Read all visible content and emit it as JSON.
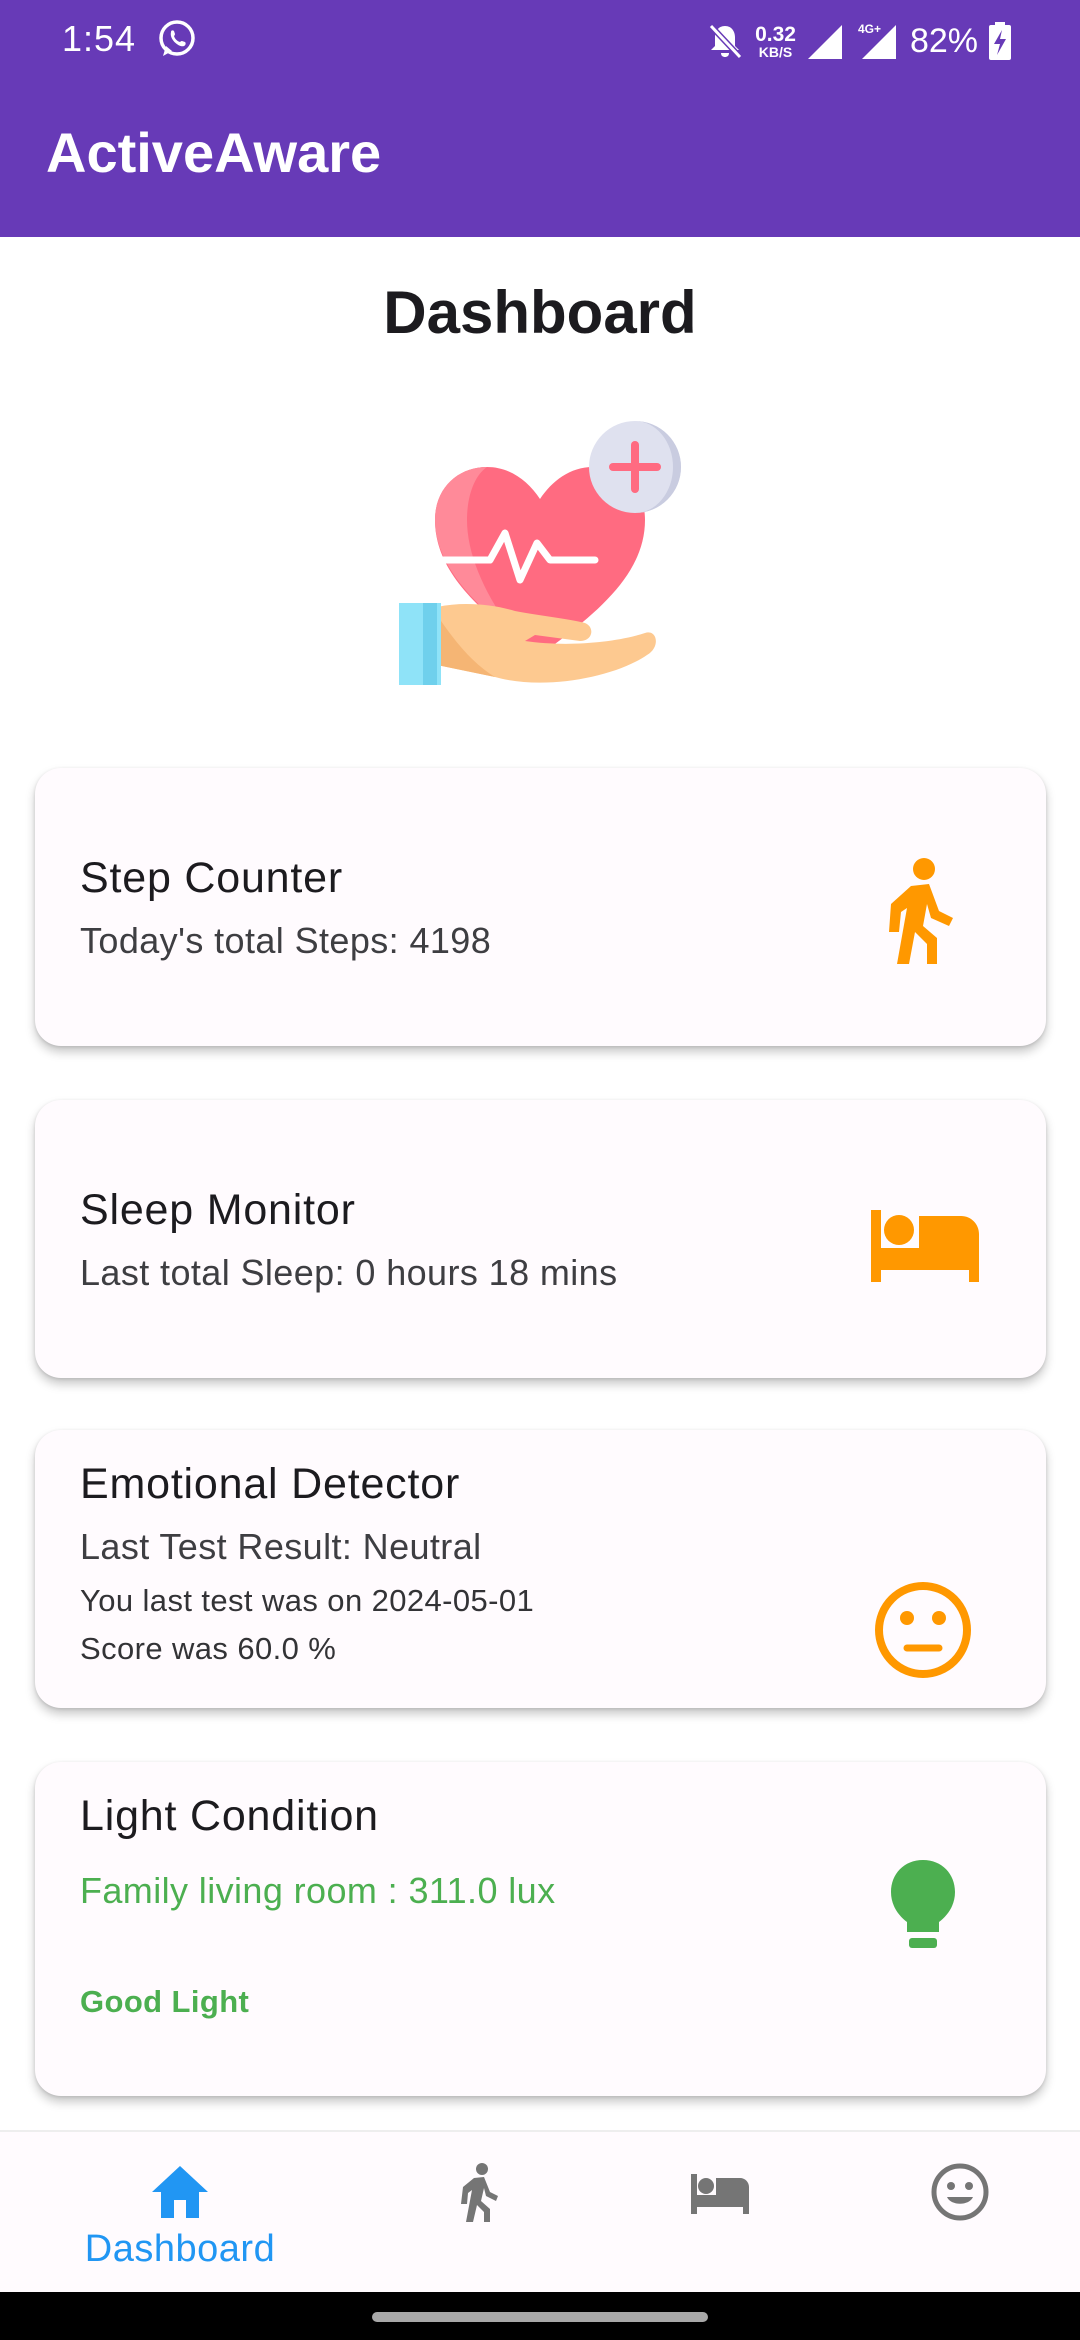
{
  "status_bar": {
    "time": "1:54",
    "net_speed_value": "0.32",
    "net_speed_unit": "KB/S",
    "network_type": "4G+",
    "battery_percent": "82%",
    "icons": [
      "whatsapp-icon",
      "bell-off-icon",
      "signal-icon",
      "battery-charging-icon"
    ]
  },
  "app_bar": {
    "title": "ActiveAware",
    "background_color": "#673ab7"
  },
  "page": {
    "title": "Dashboard",
    "hero_icon": "heart-in-hand-icon"
  },
  "cards": {
    "step_counter": {
      "title": "Step Counter",
      "subtitle": "Today's total Steps: 4198",
      "icon": "walking-person-icon",
      "icon_color": "#ff9800"
    },
    "sleep_monitor": {
      "title": "Sleep Monitor",
      "subtitle": "Last total Sleep: 0 hours 18 mins",
      "icon": "bed-icon",
      "icon_color": "#ff9800"
    },
    "emotional_detector": {
      "title": "Emotional Detector",
      "subtitle": "Last Test Result: Neutral",
      "last_test_date": "You last test was on 2024-05-01",
      "score": "Score was 60.0 %",
      "icon": "neutral-face-icon",
      "icon_color": "#ff9800"
    },
    "light_condition": {
      "title": "Light Condition",
      "reading": "Family living room : 311.0 lux",
      "status": "Good Light",
      "icon": "lightbulb-icon",
      "accent_color": "#4caf50"
    }
  },
  "bottom_nav": {
    "items": [
      {
        "label": "Dashboard",
        "icon": "home-icon",
        "selected": true
      },
      {
        "label": "",
        "icon": "walking-person-icon",
        "selected": false
      },
      {
        "label": "",
        "icon": "bed-icon",
        "selected": false
      },
      {
        "label": "",
        "icon": "smiley-face-icon",
        "selected": false
      }
    ],
    "selected_color": "#2196f3",
    "unselected_color": "#757575"
  }
}
